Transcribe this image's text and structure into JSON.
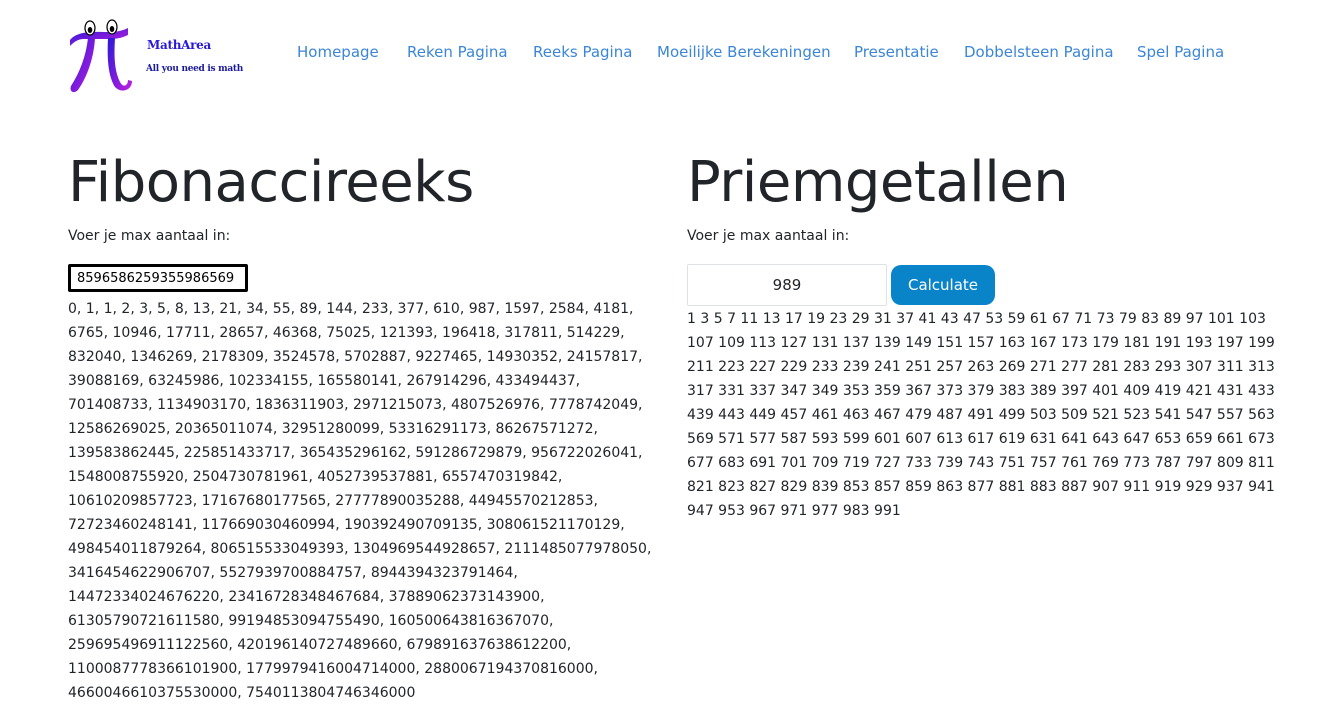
{
  "brand": {
    "title": "MathArea",
    "tagline": "All you need is math",
    "logo_icon": "pi-icon",
    "colors": {
      "pi_gradient_start": "#2a1ad6",
      "pi_gradient_end": "#c21ee0"
    }
  },
  "nav": {
    "items": [
      {
        "label": "Homepage"
      },
      {
        "label": "Reken Pagina"
      },
      {
        "label": "Reeks Pagina"
      },
      {
        "label": "Moeilijke Berekeningen"
      },
      {
        "label": "Presentatie"
      },
      {
        "label": "Dobbelsteen Pagina"
      },
      {
        "label": "Spel Pagina"
      }
    ],
    "link_color": "#3b86d6"
  },
  "fibonacci": {
    "title": "Fibonaccireeks",
    "prompt": "Voer je max aantaal in:",
    "input_value": "8596586259355986569",
    "result": "0, 1, 1, 2, 3, 5, 8, 13, 21, 34, 55, 89, 144, 233, 377, 610, 987, 1597, 2584, 4181, 6765, 10946, 17711, 28657, 46368, 75025, 121393, 196418, 317811, 514229, 832040, 1346269, 2178309, 3524578, 5702887, 9227465, 14930352, 24157817, 39088169, 63245986, 102334155, 165580141, 267914296, 433494437, 701408733, 1134903170, 1836311903, 2971215073, 4807526976, 7778742049, 12586269025, 20365011074, 32951280099, 53316291173, 86267571272, 139583862445, 225851433717, 365435296162, 591286729879, 956722026041, 1548008755920, 2504730781961, 4052739537881, 6557470319842, 10610209857723, 17167680177565, 27777890035288, 44945570212853, 72723460248141, 117669030460994, 190392490709135, 308061521170129, 498454011879264, 806515533049393, 1304969544928657, 2111485077978050, 3416454622906707, 5527939700884757, 8944394323791464, 14472334024676220, 23416728348467684, 37889062373143900, 61305790721611580, 99194853094755490, 160500643816367070, 259695496911122560, 420196140727489660, 679891637638612200, 1100087778366101900, 1779979416004714000, 2880067194370816000, 4660046610375530000, 7540113804746346000"
  },
  "primes": {
    "title": "Priemgetallen",
    "prompt": "Voer je max aantaal in:",
    "input_value": "989",
    "button_label": "Calculate",
    "button_color": "#0a84c8",
    "result": "1 3 5 7 11 13 17 19 23 29 31 37 41 43 47 53 59 61 67 71 73 79 83 89 97 101 103 107 109 113 127 131 137 139 149 151 157 163 167 173 179 181 191 193 197 199 211 223 227 229 233 239 241 251 257 263 269 271 277 281 283 293 307 311 313 317 331 337 347 349 353 359 367 373 379 383 389 397 401 409 419 421 431 433 439 443 449 457 461 463 467 479 487 491 499 503 509 521 523 541 547 557 563 569 571 577 587 593 599 601 607 613 617 619 631 641 643 647 653 659 661 673 677 683 691 701 709 719 727 733 739 743 751 757 761 769 773 787 797 809 811 821 823 827 829 839 853 857 859 863 877 881 883 887 907 911 919 929 937 941 947 953 967 971 977 983 991"
  }
}
